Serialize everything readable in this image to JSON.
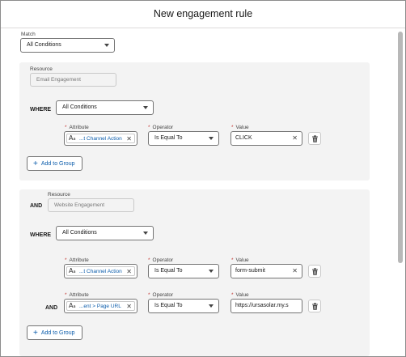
{
  "modal": {
    "title": "New engagement rule"
  },
  "match": {
    "label": "Match",
    "value": "All Conditions"
  },
  "groups": [
    {
      "resource_label": "Resource",
      "resource_value": "Email Engagement",
      "where_keyword": "WHERE",
      "where_value": "All Conditions",
      "headers": {
        "attribute": "Attribute",
        "operator": "Operator",
        "value": "Value",
        "required": "*"
      },
      "rows": [
        {
          "attribute": "...t Channel Action",
          "operator": "Is Equal To",
          "value": "CLICK"
        }
      ],
      "add_button": "Add to Group"
    },
    {
      "connector": "AND",
      "resource_label": "Resource",
      "resource_value": "Website Engagement",
      "where_keyword": "WHERE",
      "where_value": "All Conditions",
      "headers": {
        "attribute": "Attribute",
        "operator": "Operator",
        "value": "Value",
        "required": "*"
      },
      "rows": [
        {
          "attribute": "...t Channel Action",
          "operator": "Is Equal To",
          "value": "form-submit"
        },
        {
          "connector": "AND",
          "attribute": "...ent > Page URL",
          "operator": "Is Equal To",
          "value": "https://ursasolar.my.s"
        }
      ],
      "add_button": "Add to Group"
    }
  ],
  "icons": {
    "text_type": "text-type-icon",
    "clear": "close-icon",
    "delete": "trash-icon",
    "add": "plus-icon",
    "dropdown": "chevron-down-icon"
  },
  "colors": {
    "link": "#0b5cab",
    "required": "#c23934",
    "group_bg": "#f3f3f3"
  }
}
